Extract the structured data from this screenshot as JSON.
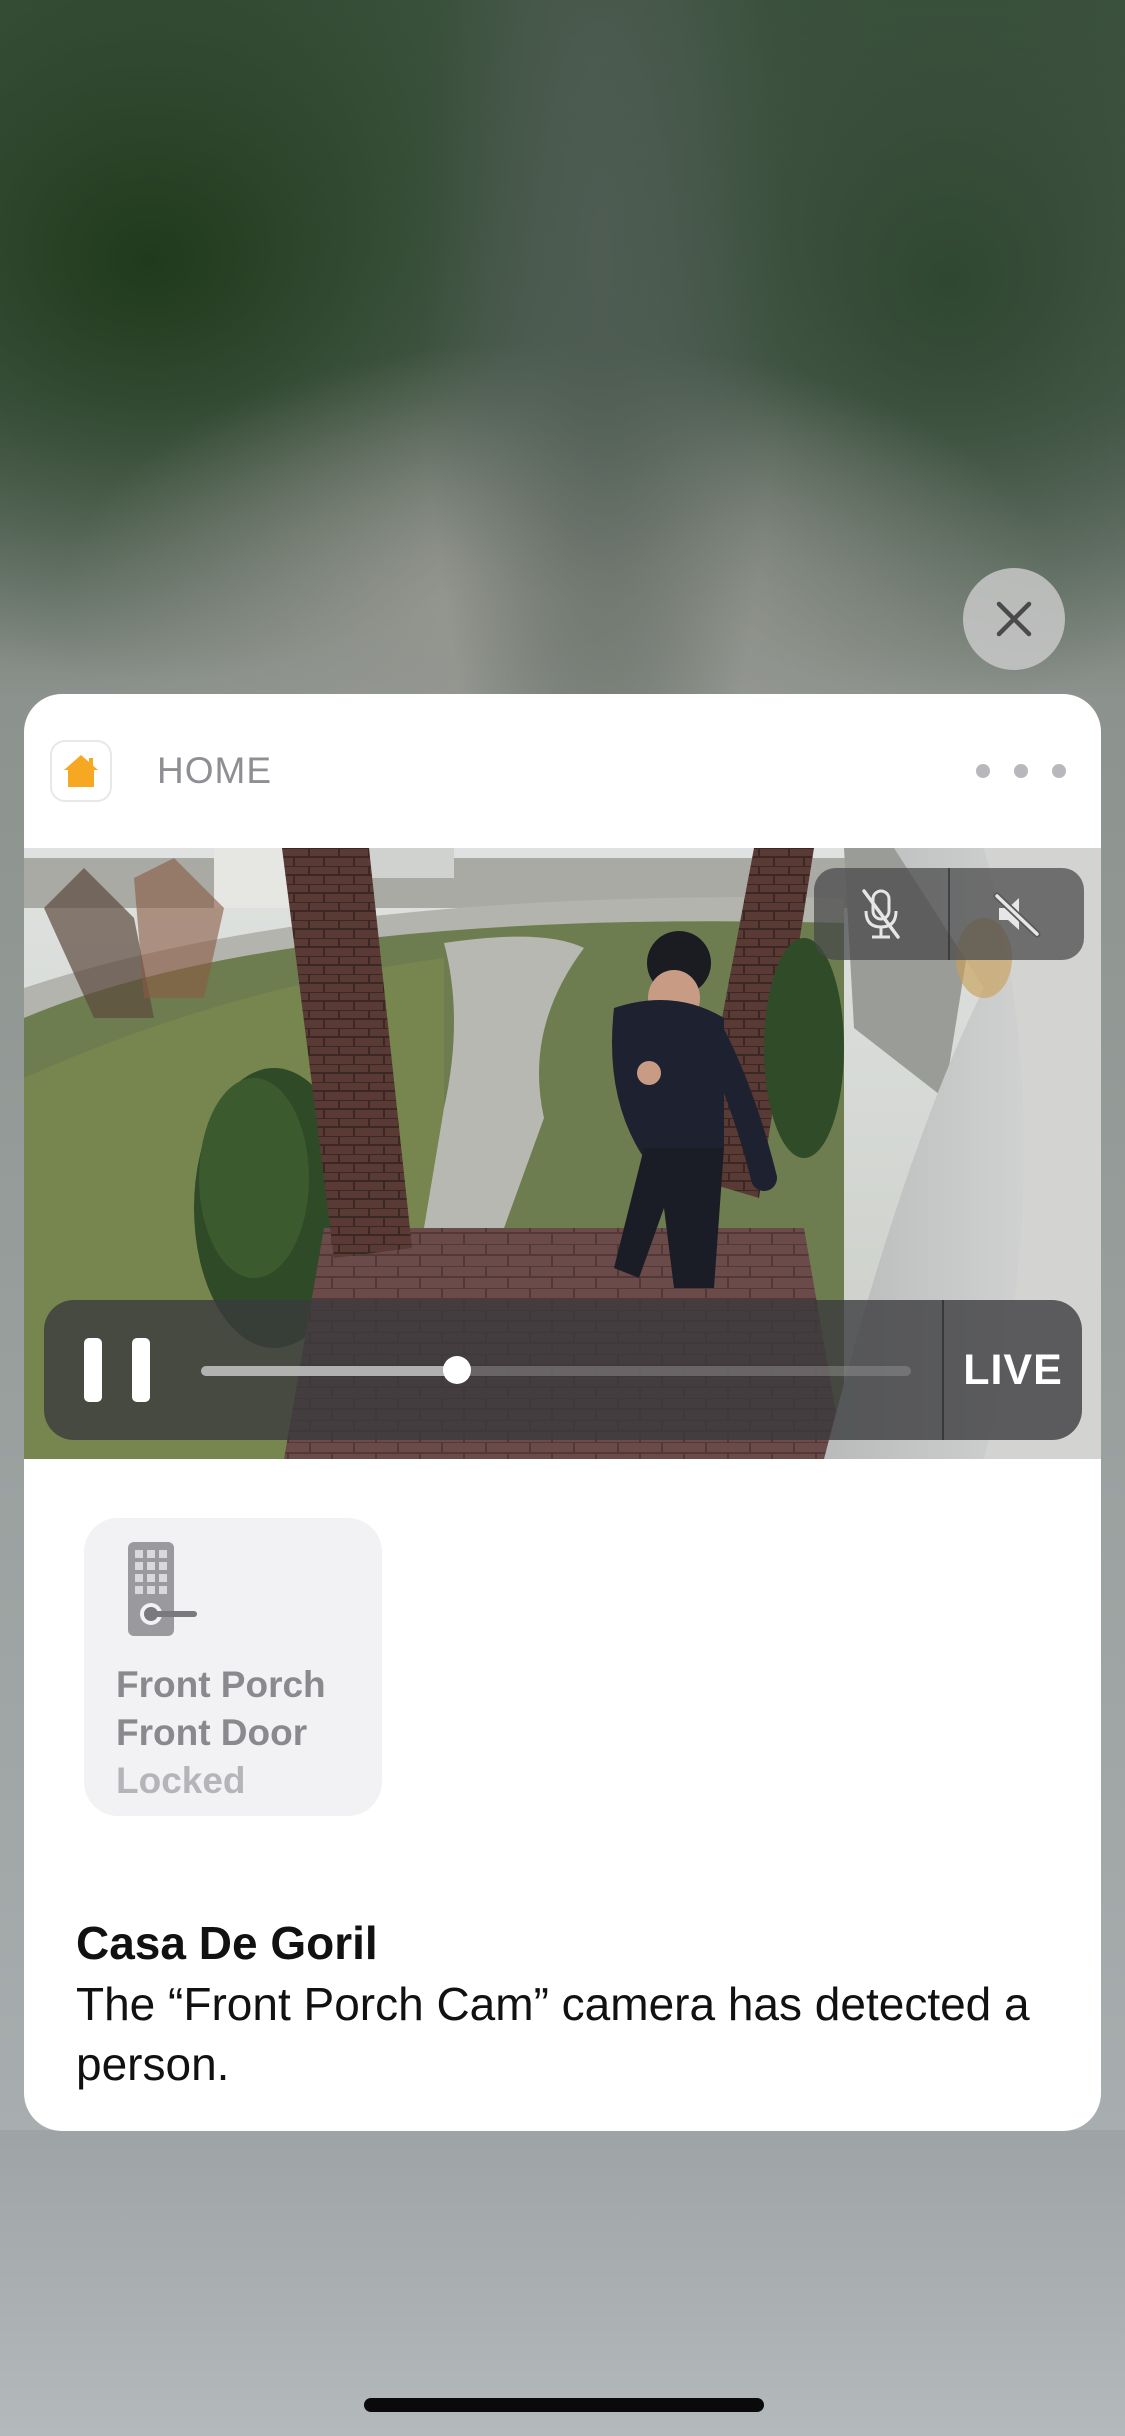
{
  "header": {
    "app_name": "HOME",
    "app_icon": "house-icon",
    "more_icon": "more-dots-icon"
  },
  "close": {
    "icon": "close-icon"
  },
  "camera": {
    "mic_icon": "microphone-muted-icon",
    "speaker_icon": "speaker-muted-icon",
    "pause_icon": "pause-icon",
    "playback_progress": 0.36,
    "live_label": "LIVE"
  },
  "accessory": {
    "icon": "door-lock-icon",
    "room": "Front Porch",
    "name": "Front Door",
    "status": "Locked"
  },
  "notification": {
    "title": "Casa De Goril",
    "body": "The “Front Porch Cam” camera has detected a person."
  },
  "colors": {
    "home_accent": "#F7A823",
    "card_background": "#FFFFFF"
  }
}
